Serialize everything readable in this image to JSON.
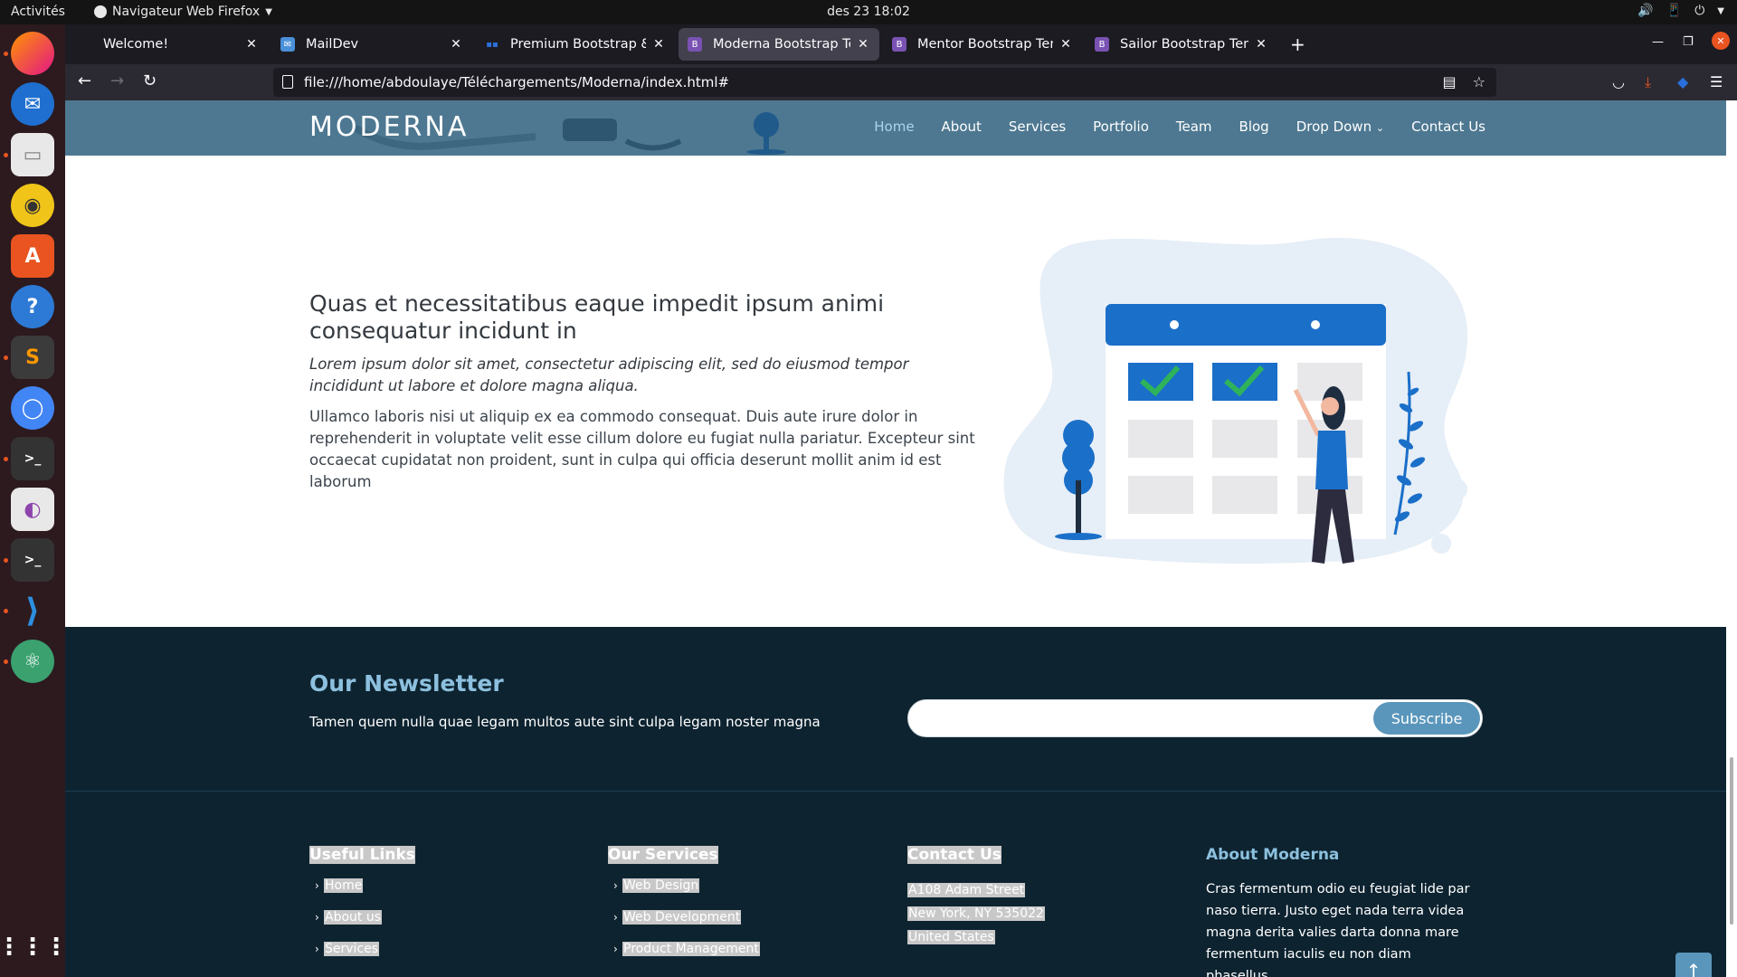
{
  "topbar": {
    "activities": "Activités",
    "app_menu": "Navigateur Web Firefox",
    "clock": "des 23  18:02"
  },
  "browser": {
    "tabs": [
      {
        "label": "Welcome!",
        "favicon_color": "#1c1b22"
      },
      {
        "label": "MailDev",
        "favicon_color": "#4a90d9"
      },
      {
        "label": "Premium Bootstrap & Ma",
        "favicon_color": "#2a6fdb"
      },
      {
        "label": "Moderna Bootstrap Temp",
        "favicon_color": "#7952b3",
        "active": true
      },
      {
        "label": "Mentor Bootstrap Templ",
        "favicon_color": "#7952b3"
      },
      {
        "label": "Sailor Bootstrap Templat",
        "favicon_color": "#7952b3"
      }
    ],
    "url": "file:///home/abdoulaye/Téléchargements/Moderna/index.html#"
  },
  "site": {
    "logo": "MODERNA",
    "nav": [
      "Home",
      "About",
      "Services",
      "Portfolio",
      "Team",
      "Blog",
      "Drop Down",
      "Contact Us"
    ],
    "feature": {
      "title": "Quas et necessitatibus eaque impedit ipsum animi consequatur incidunt in",
      "lead": "Lorem ipsum dolor sit amet, consectetur adipiscing elit, sed do eiusmod tempor incididunt ut labore et dolore magna aliqua.",
      "body": "Ullamco laboris nisi ut aliquip ex ea commodo consequat. Duis aute irure dolor in reprehenderit in voluptate velit esse cillum dolore eu fugiat nulla pariatur. Excepteur sint occaecat cupidatat non proident, sunt in culpa qui officia deserunt mollit anim id est laborum"
    },
    "newsletter": {
      "title": "Our Newsletter",
      "text": "Tamen quem nulla quae legam multos aute sint culpa legam noster magna",
      "input_value": "",
      "button": "Subscribe"
    },
    "footer": {
      "useful_links": {
        "title": "Useful Links",
        "items": [
          "Home",
          "About us",
          "Services"
        ]
      },
      "services": {
        "title": "Our Services",
        "items": [
          "Web Design",
          "Web Development",
          "Product Management"
        ]
      },
      "contact": {
        "title": "Contact Us",
        "lines": [
          "A108 Adam Street",
          "New York, NY 535022",
          "United States"
        ]
      },
      "about": {
        "title": "About Moderna",
        "text": "Cras fermentum odio eu feugiat lide par naso tierra. Justo eget nada terra videa magna derita valies darta donna mare fermentum iaculis eu non diam phasellus."
      }
    }
  },
  "colors": {
    "header_bg": "#4e7891",
    "footer_bg": "#0d2330",
    "accent": "#5a96bb",
    "calendar_blue": "#1a6fc9",
    "check_green": "#2fb35a"
  }
}
